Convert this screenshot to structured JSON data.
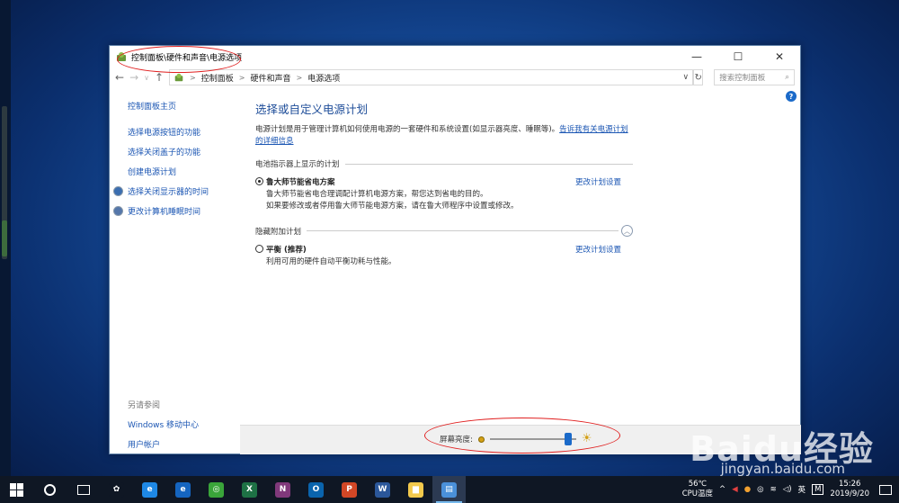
{
  "window": {
    "title": "控制面板\\硬件和声音\\电源选项",
    "controls": {
      "minimize": "—",
      "maximize": "☐",
      "close": "✕"
    }
  },
  "address_bar": {
    "back": "←",
    "forward": "→",
    "dropdown": "∨",
    "up": "↑",
    "crumbs": [
      "控制面板",
      "硬件和声音",
      "电源选项"
    ],
    "crumb_sep": ">",
    "refresh": "↻",
    "search_placeholder": "搜索控制面板",
    "search_icon": "⌕"
  },
  "help_icon": "?",
  "sidebar": {
    "home": "控制面板主页",
    "items": [
      {
        "label": "选择电源按钮的功能",
        "icon": ""
      },
      {
        "label": "选择关闭盖子的功能",
        "icon": ""
      },
      {
        "label": "创建电源计划",
        "icon": ""
      },
      {
        "label": "选择关闭显示器的时间",
        "icon": "monitor-shield-icon"
      },
      {
        "label": "更改计算机睡眠时间",
        "icon": "moon-icon"
      }
    ],
    "see_also": "另请参阅",
    "see_also_items": [
      "Windows 移动中心",
      "用户帐户"
    ]
  },
  "main": {
    "heading": "选择或自定义电源计划",
    "description": "电源计划是用于管理计算机如何使用电源的一套硬件和系统设置(如显示器亮度、睡眠等)。",
    "description_link": "告诉我有关电源计划的详细信息",
    "section_battery": "电池指示器上显示的计划",
    "plan1": {
      "name": "鲁大师节能省电方案",
      "desc1": "鲁大师节能省电合理调配计算机电源方案，帮您达到省电的目的。",
      "desc2": "如果要修改或者停用鲁大师节能电源方案，请在鲁大师程序中设置或修改。",
      "change": "更改计划设置",
      "selected": true
    },
    "section_hidden": "隐藏附加计划",
    "collapse_icon": "︿",
    "plan2": {
      "name": "平衡 (推荐)",
      "desc": "利用可用的硬件自动平衡功耗与性能。",
      "change": "更改计划设置",
      "selected": false
    }
  },
  "brightness": {
    "label": "屏幕亮度:",
    "value": 0.95,
    "high_icon": "☀"
  },
  "taskbar": {
    "apps": [
      {
        "name": "cortana",
        "label": ""
      },
      {
        "name": "task-view",
        "label": ""
      },
      {
        "name": "fan",
        "label": "✿",
        "color": "#0f1724"
      },
      {
        "name": "ie",
        "label": "e",
        "color": "#1e88e5"
      },
      {
        "name": "edge",
        "label": "e",
        "color": "#1565c0"
      },
      {
        "name": "360",
        "label": "◎",
        "color": "#3aa53a"
      },
      {
        "name": "excel",
        "label": "X",
        "color": "#1e7145"
      },
      {
        "name": "onenote",
        "label": "N",
        "color": "#80397b"
      },
      {
        "name": "outlook",
        "label": "O",
        "color": "#0a64ad"
      },
      {
        "name": "powerpoint",
        "label": "P",
        "color": "#d24726"
      },
      {
        "name": "word",
        "label": "W",
        "color": "#2b579a"
      },
      {
        "name": "explorer",
        "label": "▆",
        "color": "#f2c94c"
      },
      {
        "name": "control-panel",
        "label": "▤",
        "color": "#4a90d9"
      }
    ],
    "temp": "56℃",
    "temp_label": "CPU温度",
    "ime": "英",
    "ime2": "M",
    "time": "15:26",
    "date": "2019/9/20",
    "tray_up": "^"
  },
  "watermark": {
    "brand": "Baidu经验",
    "url": "jingyan.baidu.com"
  }
}
